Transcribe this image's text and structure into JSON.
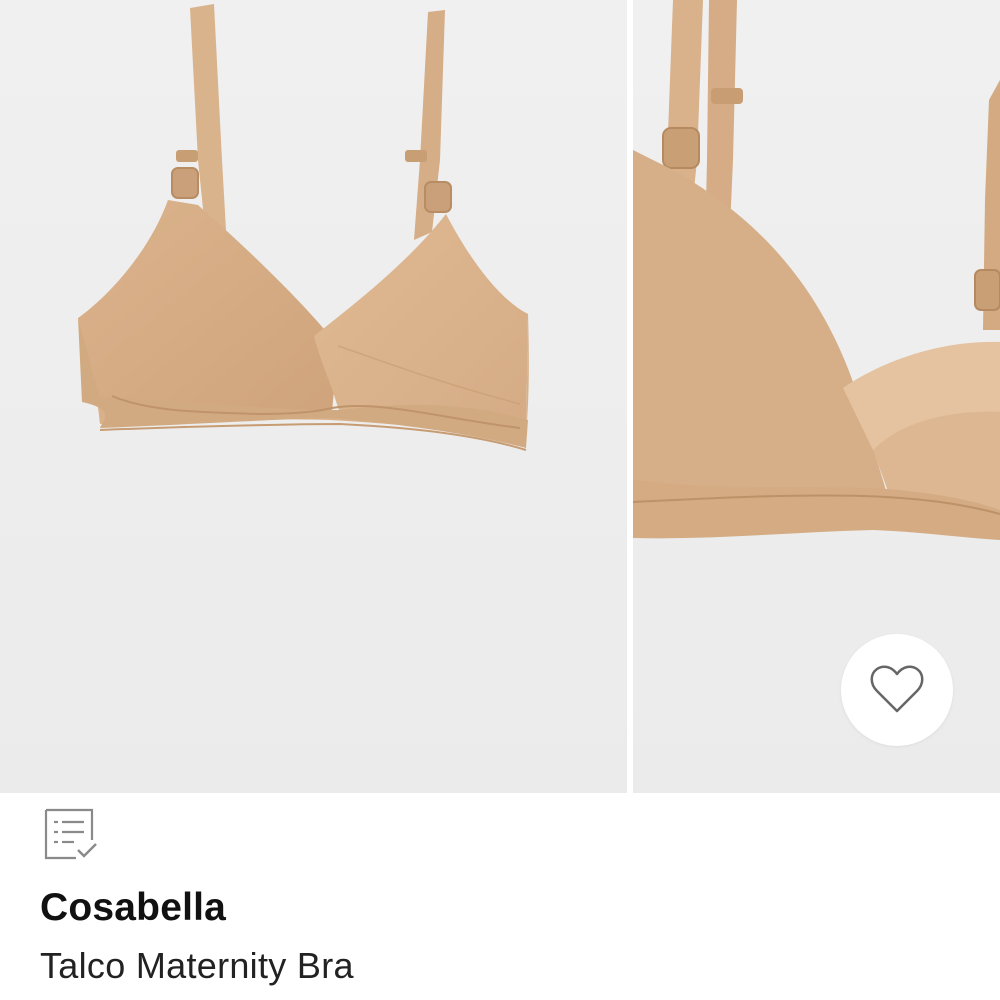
{
  "product": {
    "brand": "Cosabella",
    "name": "Talco Maternity Bra"
  },
  "icons": {
    "favorite": "heart-outline-icon",
    "details": "checklist-document-icon"
  },
  "colors": {
    "fabric": "#dcb48c",
    "background": "#ececec",
    "text": "#111111"
  }
}
